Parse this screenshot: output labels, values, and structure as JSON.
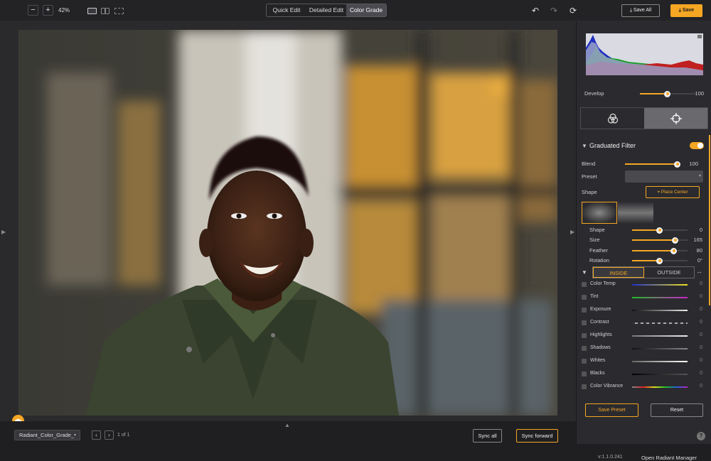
{
  "toolbar": {
    "zoom_out": "−",
    "zoom_in": "+",
    "zoom": "42%",
    "tabs": [
      {
        "label": "Quick Edit",
        "active": false
      },
      {
        "label": "Detailed Edit",
        "active": false
      },
      {
        "label": "Color Grade",
        "active": true
      }
    ],
    "undo_icon": "↶",
    "redo_icon": "↷",
    "reset_icon": "⟳",
    "save_all": "⤓ Save All",
    "save": "⤓ Save"
  },
  "bottom": {
    "preset": "Radiant_Color_Grade_",
    "prev": "‹",
    "next": "›",
    "page": "1 of 1",
    "sync_all": "Sync all",
    "sync_forward": "Sync forward"
  },
  "panel": {
    "develop_label": "Develop",
    "develop_value": "100",
    "develop_level": 100,
    "section_title": "Graduated Filter",
    "blend_label": "Blend",
    "blend_value": "100",
    "preset_label": "Preset",
    "shape_label": "Shape",
    "place_center": "⌖  Place Center",
    "sliders": [
      {
        "label": "Shape",
        "value": "0"
      },
      {
        "label": "Size",
        "value": "165"
      },
      {
        "label": "Feather",
        "value": "80"
      },
      {
        "label": "Rotation",
        "value": "0°"
      }
    ],
    "inside": "INSIDE",
    "outside": "OUTSIDE",
    "adjustments": [
      {
        "label": "Color Temp",
        "value": "0"
      },
      {
        "label": "Tint",
        "value": "0"
      },
      {
        "label": "Exposure",
        "value": "0"
      },
      {
        "label": "Contrast",
        "value": "0"
      },
      {
        "label": "Highlights",
        "value": "0"
      },
      {
        "label": "Shadows",
        "value": "0"
      },
      {
        "label": "Whites",
        "value": "0"
      },
      {
        "label": "Blacks",
        "value": "0"
      },
      {
        "label": "Color Vibrance",
        "value": "0"
      }
    ],
    "save_preset": "Save Preset",
    "reset": "Reset",
    "version": "v:1.1.0.241",
    "open_manager": "Open Radiant Manager",
    "help": "?"
  },
  "colors": {
    "accent": "#f5a623",
    "panel_bg": "#2b2b2f",
    "toolbar_bg": "#232326"
  }
}
